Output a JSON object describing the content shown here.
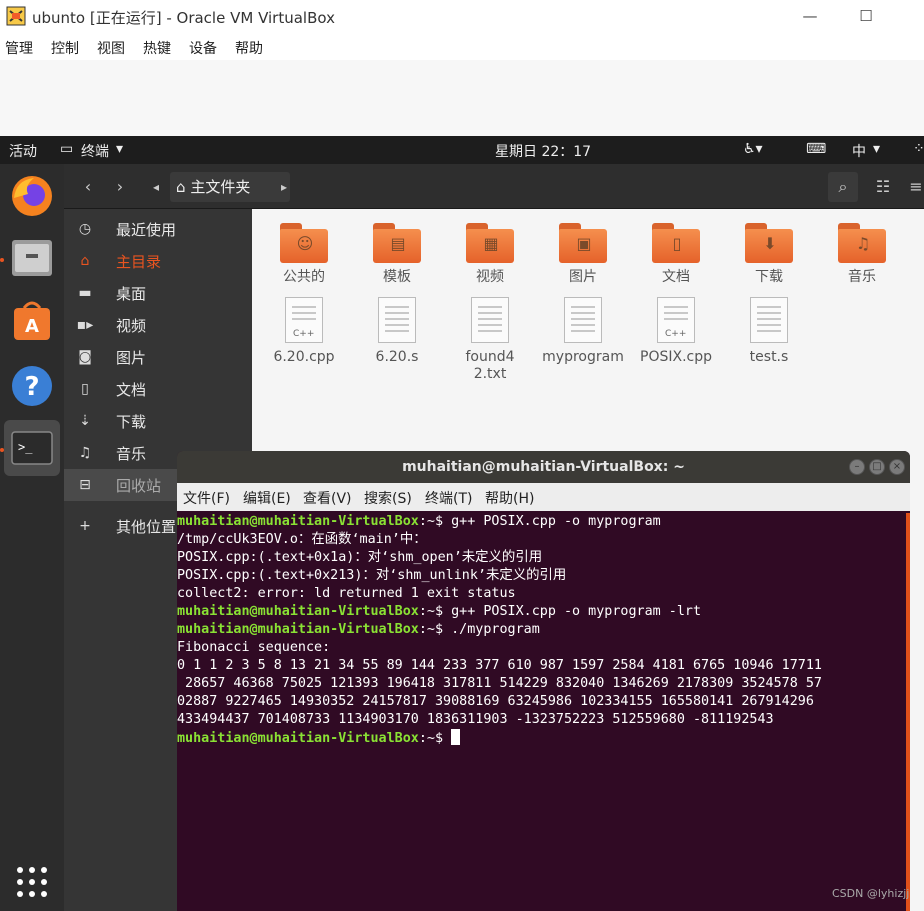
{
  "vbox": {
    "title": "ubunto [正在运行] - Oracle VM VirtualBox",
    "menu": [
      "管理",
      "控制",
      "视图",
      "热键",
      "设备",
      "帮助"
    ]
  },
  "topbar": {
    "activities": "活动",
    "app_menu": "终端",
    "clock": "星期日 22：17",
    "input_method": "中"
  },
  "nautilus": {
    "path_label": "主文件夹",
    "sidebar": [
      {
        "label": "最近使用",
        "icon": "clock-icon"
      },
      {
        "label": "主目录",
        "icon": "home-icon"
      },
      {
        "label": "桌面",
        "icon": "folder-icon"
      },
      {
        "label": "视频",
        "icon": "video-icon"
      },
      {
        "label": "图片",
        "icon": "camera-icon"
      },
      {
        "label": "文档",
        "icon": "document-icon"
      },
      {
        "label": "下载",
        "icon": "download-icon"
      },
      {
        "label": "音乐",
        "icon": "music-icon"
      },
      {
        "label": "回收站",
        "icon": "trash-icon"
      },
      {
        "label": "其他位置",
        "icon": "plus-icon"
      }
    ],
    "folders": [
      "公共的",
      "模板",
      "视频",
      "图片",
      "文档",
      "下载",
      "音乐"
    ],
    "files": [
      "6.20.cpp",
      "6.20.s",
      "found42.txt",
      "myprogram",
      "POSIX.cpp",
      "test.s"
    ]
  },
  "terminal": {
    "title": "muhaitian@muhaitian-VirtualBox: ~",
    "menu": [
      "文件(F)",
      "编辑(E)",
      "查看(V)",
      "搜索(S)",
      "终端(T)",
      "帮助(H)"
    ],
    "prompt": "muhaitian@muhaitian-VirtualBox",
    "lines": [
      {
        "prompt": "muhaitian@muhaitian-VirtualBox",
        "text": ":~$ g++ POSIX.cpp -o myprogram"
      },
      {
        "text": "/tmp/ccUk3EOV.o：在函数‘main’中："
      },
      {
        "text": "POSIX.cpp:(.text+0x1a)：对‘shm_open’未定义的引用"
      },
      {
        "text": "POSIX.cpp:(.text+0x213)：对‘shm_unlink’未定义的引用"
      },
      {
        "text": "collect2: error: ld returned 1 exit status"
      },
      {
        "prompt": "muhaitian@muhaitian-VirtualBox",
        "text": ":~$ g++ POSIX.cpp -o myprogram -lrt"
      },
      {
        "prompt": "muhaitian@muhaitian-VirtualBox",
        "text": ":~$ ./myprogram"
      },
      {
        "text": "Fibonacci sequence:"
      },
      {
        "text": "0 1 1 2 3 5 8 13 21 34 55 89 144 233 377 610 987 1597 2584 4181 6765 10946 17711"
      },
      {
        "text": " 28657 46368 75025 121393 196418 317811 514229 832040 1346269 2178309 3524578 57"
      },
      {
        "text": "02887 9227465 14930352 24157817 39088169 63245986 102334155 165580141 267914296"
      },
      {
        "text": "433494437 701408733 1134903170 1836311903 -1323752223 512559680 -811192543"
      },
      {
        "prompt": "muhaitian@muhaitian-VirtualBox",
        "text": ":~$ "
      }
    ]
  },
  "watermark": "CSDN @lyhizjj"
}
